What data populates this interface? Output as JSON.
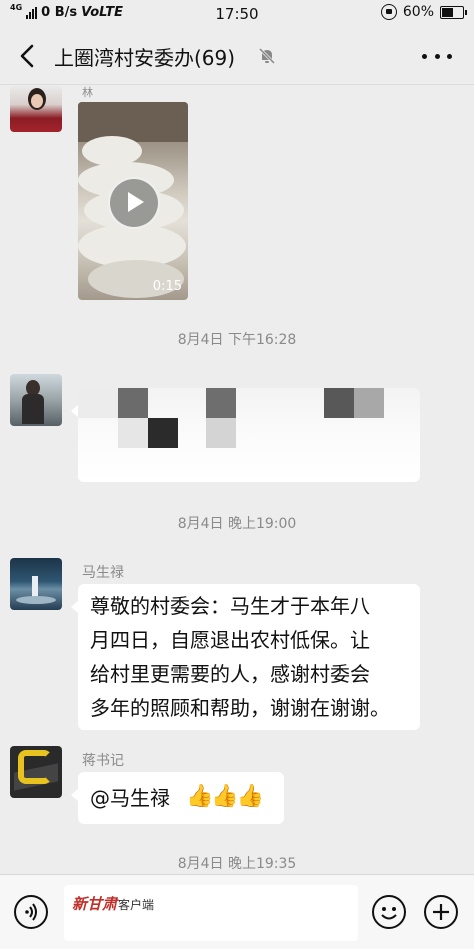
{
  "status": {
    "network_type": "4G",
    "speed": "0 B/s",
    "volte": "VoLTE",
    "time": "17:50",
    "battery": "60%",
    "battery_fraction": 0.6
  },
  "header": {
    "title": "上圈湾村安委办(69)"
  },
  "messages": {
    "video": {
      "sender": "林",
      "duration": "0:15"
    },
    "ts1": "8月4日 下午16:28",
    "ts2": "8月4日 晚上19:00",
    "text_msg": {
      "sender": "马生禄",
      "lines": [
        "尊敬的村委会：马生才于本年八",
        "月四日，自愿退出农村低保。让",
        "给村里更需要的人，感谢村委会",
        "多年的照顾和帮助，谢谢在谢谢。"
      ]
    },
    "mention_msg": {
      "sender": "蒋书记",
      "text": "@马生禄",
      "emoji": "👍👍👍"
    },
    "ts3": "8月4日 晚上19:35"
  },
  "input": {
    "watermark_brand": "新甘肃",
    "watermark_sub": "客户端"
  },
  "colors": {
    "bg": "#ededed",
    "bubble": "#ffffff",
    "meta": "#8a8a8a"
  }
}
